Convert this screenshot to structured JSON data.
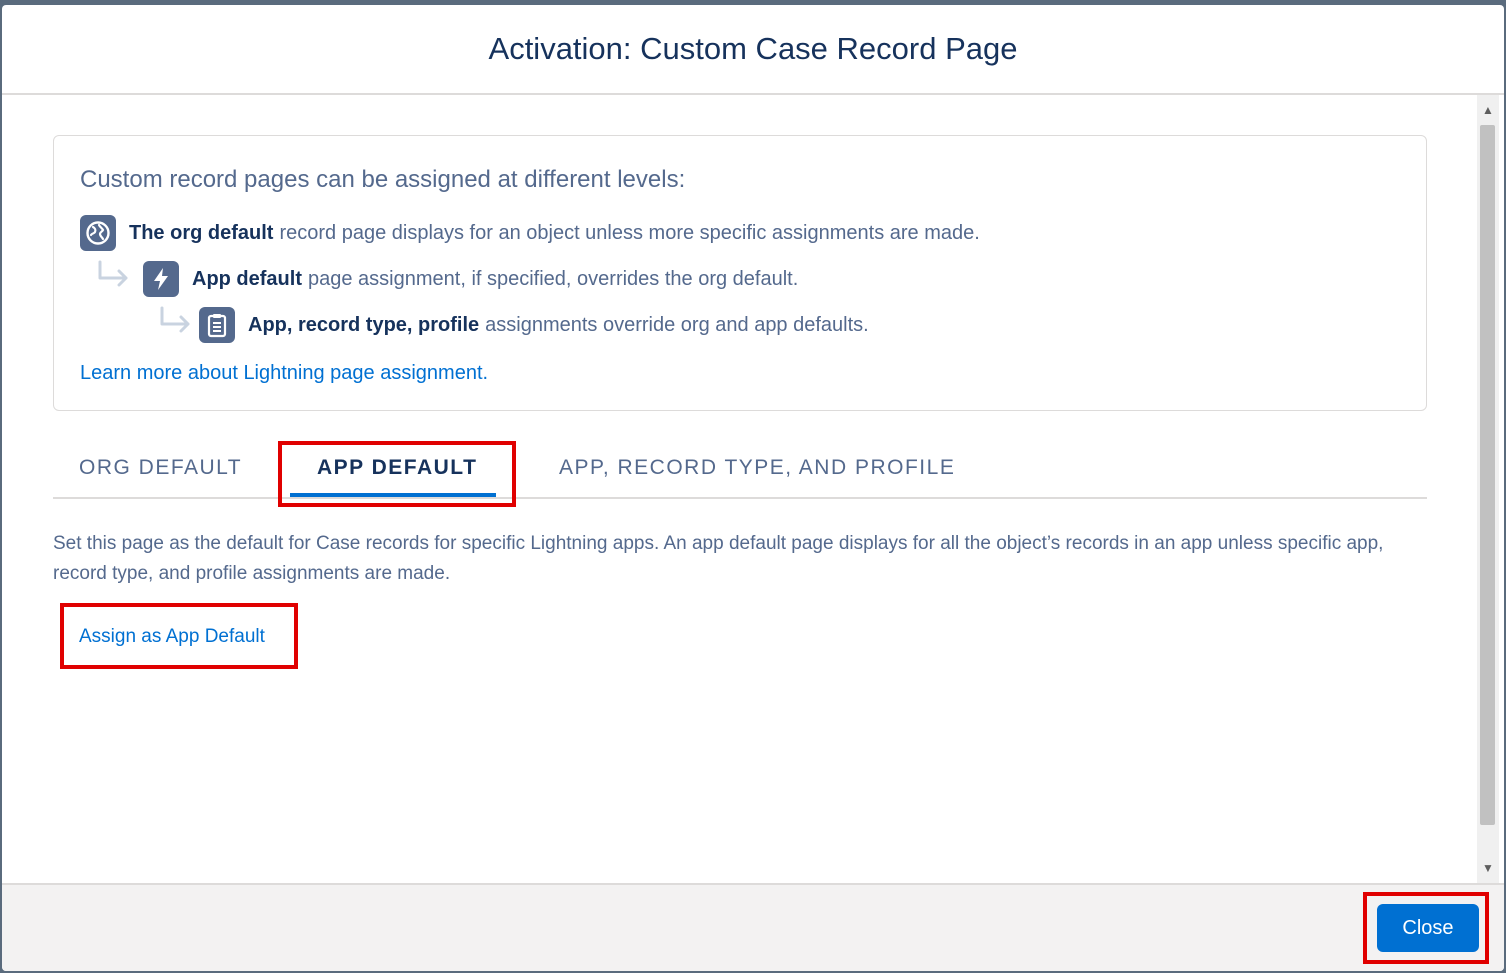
{
  "modal": {
    "title": "Activation: Custom Case Record Page"
  },
  "info": {
    "heading": "Custom record pages can be assigned at different levels:",
    "levels": [
      {
        "strong": "The org default",
        "text": "record page displays for an object unless more specific assignments are made.",
        "icon": "globe-icon"
      },
      {
        "strong": "App default",
        "text": "page assignment, if specified, overrides the org default.",
        "icon": "lightning-icon"
      },
      {
        "strong": "App, record type, profile",
        "text": "assignments override org and app defaults.",
        "icon": "clipboard-icon"
      }
    ],
    "learn_more_link": "Learn more about Lightning page assignment."
  },
  "tabs": [
    {
      "label": "ORG DEFAULT",
      "active": false
    },
    {
      "label": "APP DEFAULT",
      "active": true
    },
    {
      "label": "APP, RECORD TYPE, AND PROFILE",
      "active": false
    }
  ],
  "app_default_panel": {
    "description": "Set this page as the default for Case records for specific Lightning apps. An app default page displays for all the object’s records in an app unless specific app, record type, and profile assignments are made.",
    "assign_link": "Assign as App Default"
  },
  "footer": {
    "close_label": "Close"
  },
  "colors": {
    "brand_blue": "#0070d2",
    "title_navy": "#16325c",
    "icon_slate": "#54698d",
    "highlight_red": "#e00000"
  }
}
